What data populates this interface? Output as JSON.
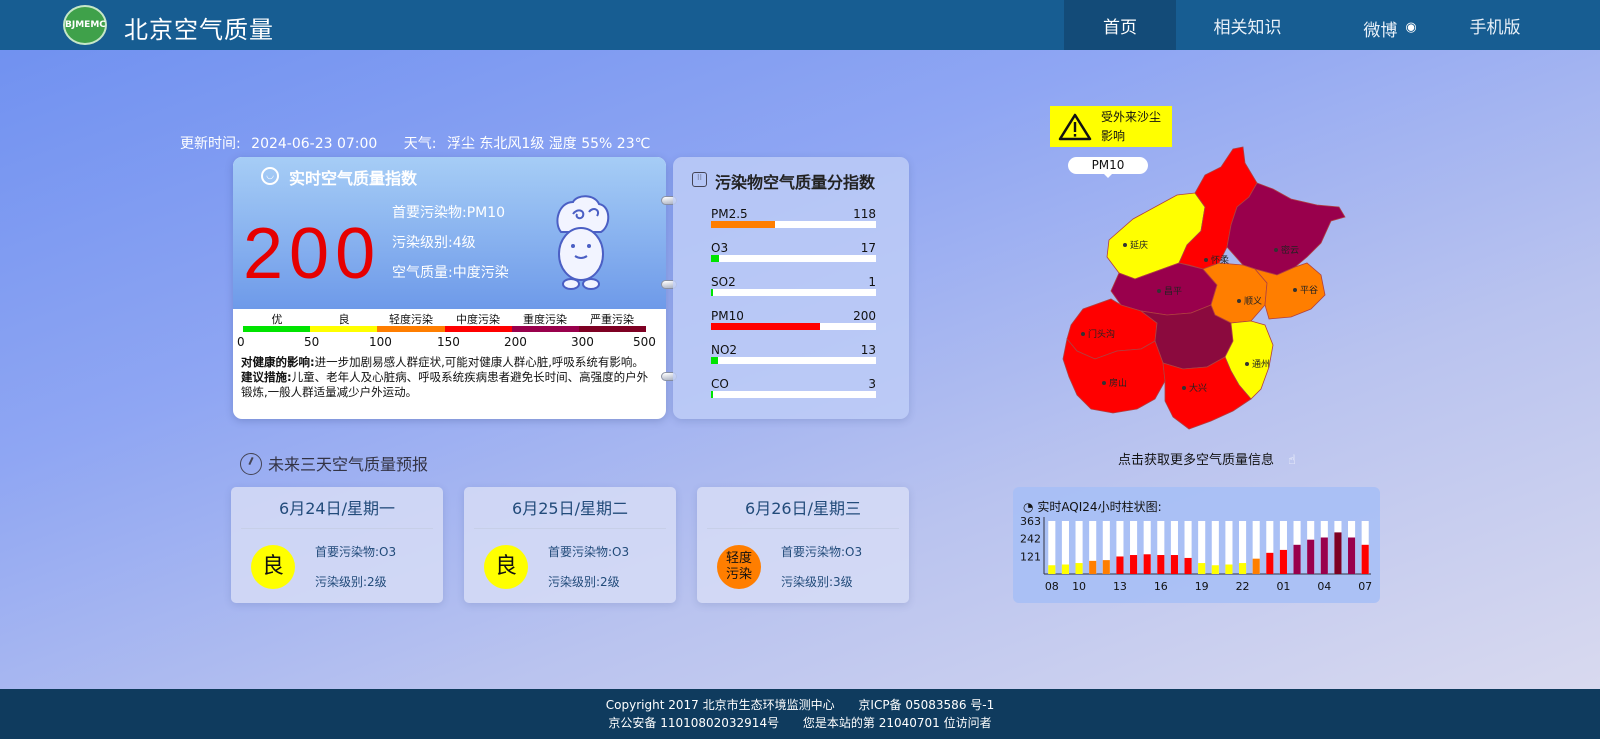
{
  "header": {
    "logo_text": "BJMEMC",
    "title": "北京空气质量",
    "nav": [
      {
        "label": "首页",
        "active": true
      },
      {
        "label": "相关知识",
        "active": false
      },
      {
        "label": "微博",
        "active": false,
        "icon": "weibo-icon"
      },
      {
        "label": "手机版",
        "active": false
      }
    ]
  },
  "update": {
    "time_label": "更新时间:",
    "time_value": "2024-06-23 07:00",
    "weather_label": "天气:",
    "weather_value": "浮尘 东北风1级 湿度 55% 23℃"
  },
  "realtime": {
    "title": "实时空气质量指数",
    "aqi": "200",
    "primary_pollutant": "首要污染物:PM10",
    "level": "污染级别:4级",
    "quality": "空气质量:中度污染",
    "scale_labels": [
      "优",
      "良",
      "轻度污染",
      "中度污染",
      "重度污染",
      "严重污染"
    ],
    "scale_numbers": [
      "0",
      "50",
      "100",
      "150",
      "200",
      "300",
      "500"
    ],
    "scale_colors": [
      "#00e400",
      "#ffff00",
      "#ff7e00",
      "#ff0000",
      "#99004c",
      "#7e0023"
    ],
    "health_label": "对健康的影响:",
    "health_text": "进一步加剧易感人群症状,可能对健康人群心脏,呼吸系统有影响。",
    "advice_label": "建议措施:",
    "advice_text": "儿童、老年人及心脏病、呼吸系统疾病患者避免长时间、高强度的户外锻炼,一般人群适量减少户外运动。"
  },
  "pollutants": {
    "title": "污染物空气质量分指数",
    "items": [
      {
        "name": "PM2.5",
        "value": "118",
        "fraction": 0.39,
        "color": "#ff7e00"
      },
      {
        "name": "O3",
        "value": "17",
        "fraction": 0.05,
        "color": "#00e400"
      },
      {
        "name": "SO2",
        "value": "1",
        "fraction": 0.01,
        "color": "#00e400"
      },
      {
        "name": "PM10",
        "value": "200",
        "fraction": 0.66,
        "color": "#ff0000"
      },
      {
        "name": "NO2",
        "value": "13",
        "fraction": 0.04,
        "color": "#00e400"
      },
      {
        "name": "CO",
        "value": "3",
        "fraction": 0.01,
        "color": "#00e400"
      }
    ]
  },
  "forecast": {
    "title": "未来三天空气质量预报",
    "days": [
      {
        "date": "6月24日/星期一",
        "badge_line1": "良",
        "badge_line2": "",
        "badge_color": "#ffff00",
        "primary": "首要污染物:O3",
        "level": "污染级别:2级"
      },
      {
        "date": "6月25日/星期二",
        "badge_line1": "良",
        "badge_line2": "",
        "badge_color": "#ffff00",
        "primary": "首要污染物:O3",
        "level": "污染级别:2级"
      },
      {
        "date": "6月26日/星期三",
        "badge_line1": "轻度",
        "badge_line2": "污染",
        "badge_color": "#ff7e00",
        "primary": "首要污染物:O3",
        "level": "污染级别:3级"
      }
    ]
  },
  "map": {
    "warning_text": "受外来沙尘影响",
    "pollutant_tag": "PM10",
    "district_labels": [
      "延庆",
      "怀柔",
      "密云",
      "昌平",
      "顺义",
      "平谷",
      "门头沟",
      "通州",
      "房山",
      "大兴"
    ],
    "more_info": "点击获取更多空气质量信息"
  },
  "chart_data": {
    "type": "bar",
    "title": "实时AQI24小时柱状图:",
    "x_tick_labels": [
      "08",
      "10",
      "13",
      "16",
      "19",
      "22",
      "01",
      "04",
      "07"
    ],
    "y_tick_labels": [
      "363",
      "242",
      "121"
    ],
    "ylim": [
      0,
      363
    ],
    "categories": [
      "08",
      "09",
      "10",
      "11",
      "12",
      "13",
      "14",
      "15",
      "16",
      "17",
      "18",
      "19",
      "20",
      "21",
      "22",
      "23",
      "00",
      "01",
      "02",
      "03",
      "04",
      "05",
      "06",
      "07"
    ],
    "values": [
      60,
      65,
      75,
      90,
      95,
      120,
      130,
      135,
      130,
      130,
      110,
      75,
      60,
      65,
      75,
      105,
      145,
      165,
      200,
      235,
      250,
      285,
      250,
      200
    ],
    "bar_colors": [
      "#ffff00",
      "#ffff00",
      "#ffff00",
      "#ff7e00",
      "#ff7e00",
      "#ff0000",
      "#ff0000",
      "#ff0000",
      "#ff0000",
      "#ff0000",
      "#ff0000",
      "#ffff00",
      "#ffff00",
      "#ffff00",
      "#ffff00",
      "#ff7e00",
      "#ff0000",
      "#ff0000",
      "#99004c",
      "#99004c",
      "#99004c",
      "#7e0023",
      "#99004c",
      "#ff0000"
    ]
  },
  "footer": {
    "copyright": "Copyright 2017 北京市生态环境监测中心",
    "icp": "京ICP备 05083586 号-1",
    "police": "京公安备 11010802032914号",
    "visitors": "您是本站的第 21040701 位访问者"
  }
}
